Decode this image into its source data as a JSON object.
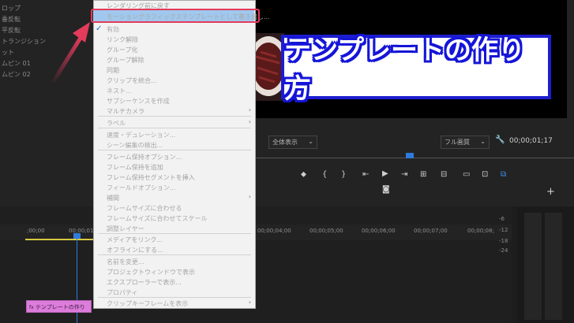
{
  "left_panel": {
    "items": [
      "ロップ",
      "垂反転",
      "平反転",
      "トランジション",
      "ット",
      "ムピン 01",
      "ムピン 02"
    ]
  },
  "context_menu": {
    "items": [
      {
        "label": "レンダリング前に戻す",
        "enabled": false
      },
      {
        "label": "モーショングラフィックステンプレートとして書き出し...",
        "enabled": true,
        "highlighted": true
      },
      {
        "label": "有効",
        "enabled": true,
        "checked": true
      },
      {
        "label": "リンク解除",
        "enabled": false
      },
      {
        "label": "グループ化",
        "enabled": false
      },
      {
        "label": "グループ解除",
        "enabled": false
      },
      {
        "label": "同期",
        "enabled": false
      },
      {
        "label": "クリップを統合...",
        "enabled": false
      },
      {
        "label": "ネスト...",
        "enabled": true
      },
      {
        "label": "サブシーケンスを作成",
        "enabled": true
      },
      {
        "label": "マルチカメラ",
        "enabled": false,
        "submenu": true
      },
      {
        "label": "ラベル",
        "enabled": true,
        "submenu": true
      },
      {
        "label": "速度・デュレーション...",
        "enabled": true
      },
      {
        "label": "シーン編集の検出...",
        "enabled": true
      },
      {
        "label": "フレーム保持オプション...",
        "enabled": false
      },
      {
        "label": "フレーム保持を追加",
        "enabled": false
      },
      {
        "label": "フレーム保持セグメントを挿入",
        "enabled": false
      },
      {
        "label": "フィールドオプション...",
        "enabled": true
      },
      {
        "label": "補間",
        "enabled": false,
        "submenu": true
      },
      {
        "label": "フレームサイズに合わせる",
        "enabled": true
      },
      {
        "label": "フレームサイズに合わせてスケール",
        "enabled": true
      },
      {
        "label": "調整レイヤー",
        "enabled": true
      },
      {
        "label": "メディアをリンク...",
        "enabled": false
      },
      {
        "label": "オフラインにする...",
        "enabled": false
      },
      {
        "label": "名前を変更...",
        "enabled": true
      },
      {
        "label": "プロジェクトウィンドウで表示",
        "enabled": false
      },
      {
        "label": "エクスプローラーで表示...",
        "enabled": false
      },
      {
        "label": "プロパティ",
        "enabled": true
      },
      {
        "label": "クリップキーフレームを表示",
        "enabled": true,
        "submenu": true
      }
    ]
  },
  "monitor": {
    "title_card_text": "テンプレートの作り方",
    "zoom_select": "全体表示",
    "quality_select": "フル画質",
    "timecode": "00;00;01;17"
  },
  "timeline": {
    "timecodes": [
      ";00;00",
      "00;00;01",
      "00;00;04;00",
      "00;00;05;00",
      "00;00;06;00",
      "00;00;07;00",
      "00;00;08;"
    ],
    "clip_label": "テンプレートの作り"
  },
  "meter": {
    "ticks": [
      "-6",
      "-12",
      "-18",
      "-24"
    ]
  },
  "colors": {
    "menu_highlight": "#a0c8ee",
    "callout_red": "#e33b5c",
    "title_blue": "#1515d8",
    "clip_pink": "#dc7cdb",
    "playhead_blue": "#2e7bdc"
  }
}
